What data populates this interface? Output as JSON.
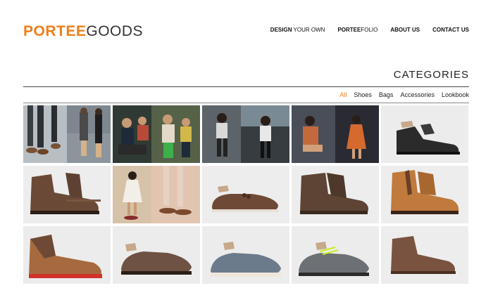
{
  "brand": {
    "part1": "PORTEE",
    "part2": "GOODS"
  },
  "nav": [
    {
      "bold": "DESIGN",
      "rest": " YOUR OWN"
    },
    {
      "bold": "PORTEE",
      "rest": "FOLIO"
    },
    {
      "bold": "ABOUT US",
      "rest": ""
    },
    {
      "bold": "CONTACT US",
      "rest": ""
    }
  ],
  "categories": {
    "title": "CATEGORIES",
    "filters": [
      "All",
      "Shoes",
      "Bags",
      "Accessories",
      "Lookbook"
    ],
    "active": "All"
  },
  "colors": {
    "accent": "#f07e1b",
    "text": "#222222"
  },
  "tiles": [
    "lookbook-photo-legs-and-shoes",
    "lookbook-photo-group",
    "lookbook-photo-women-outdoor",
    "lookbook-photo-orange-dress",
    "shoe-black-wingtip-boot",
    "shoe-brown-chukka-boot",
    "lookbook-photo-girl-white-dress",
    "shoe-brown-tassel-loafer",
    "shoe-brown-suede-boot",
    "shoe-tan-leather-boot",
    "shoe-two-tone-red-sole-boot",
    "shoe-brown-wingtip-derby",
    "shoe-grey-blue-wingtip",
    "shoe-grey-wingtip-neon-laces",
    "shoe-brown-chukka-low"
  ]
}
